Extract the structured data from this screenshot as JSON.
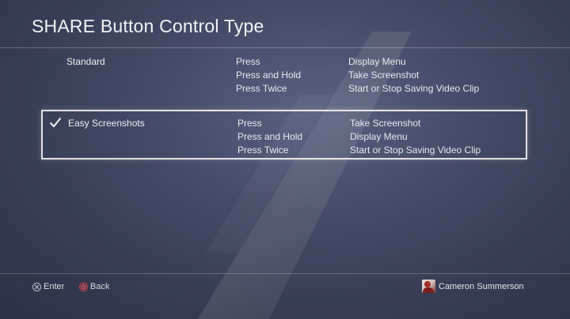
{
  "header": {
    "title": "SHARE Button Control Type"
  },
  "options": [
    {
      "name": "Standard",
      "selected": false,
      "mappings": [
        {
          "action": "Press",
          "result": "Display Menu"
        },
        {
          "action": "Press and Hold",
          "result": "Take Screenshot"
        },
        {
          "action": "Press Twice",
          "result": "Start or Stop Saving Video Clip"
        }
      ]
    },
    {
      "name": "Easy Screenshots",
      "selected": true,
      "mappings": [
        {
          "action": "Press",
          "result": "Take Screenshot"
        },
        {
          "action": "Press and Hold",
          "result": "Display Menu"
        },
        {
          "action": "Press Twice",
          "result": "Start or Stop Saving Video Clip"
        }
      ]
    }
  ],
  "footer": {
    "enter_label": "Enter",
    "enter_icon": "cross-button-icon",
    "back_label": "Back",
    "back_icon": "circle-button-icon",
    "user_name": "Cameron Summerson",
    "user_icon": "avatar-icon"
  },
  "colors": {
    "background": "#454b68",
    "text": "#e6e8ef",
    "selection_border": "#ffffff",
    "back_button": "#c0404a"
  }
}
